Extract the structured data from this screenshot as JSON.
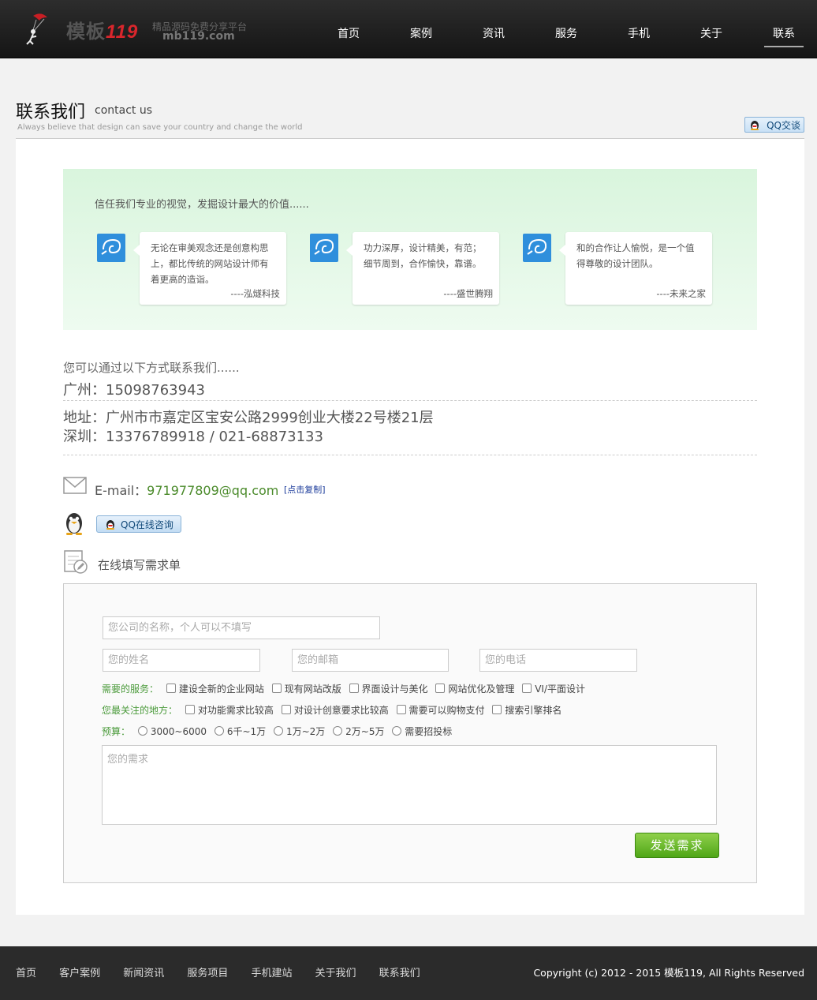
{
  "header": {
    "logo_cn": "模板",
    "logo_num": "119",
    "slogan": "精品源码免费分享平台",
    "domain": "mb119.com",
    "nav": [
      "首页",
      "案例",
      "资讯",
      "服务",
      "手机",
      "关于",
      "联系"
    ],
    "active_nav": "联系"
  },
  "page_title": {
    "cn": "联系我们",
    "en": "contact us",
    "subtitle": "Always believe that design can save your country and change the world",
    "qq_talk": "QQ交谈"
  },
  "testimonials": {
    "headline": "信任我们专业的视觉，发掘设计最大的价值......",
    "items": [
      {
        "text": "无论在审美观念还是创意构思上，都比传统的网站设计师有着更高的造诣。",
        "sign": "----泓燧科技"
      },
      {
        "text": "功力深厚，设计精美，有范；细节周到，合作愉快，靠谱。",
        "sign": "----盛世腾翔"
      },
      {
        "text": "和的合作让人愉悦，是一个值得尊敬的设计团队。",
        "sign": "----未来之家"
      }
    ]
  },
  "contact": {
    "intro": "您可以通过以下方式联系我们......",
    "guangzhou": "广州：15098763943",
    "address": "地址：广州市市嘉定区宝安公路2999创业大楼22号楼21层",
    "shenzhen": "深圳：13376789918 / 021-68873133",
    "email_label": "E-mail：",
    "email": "971977809@qq.com",
    "copy_link": "[点击复制]",
    "qq_online": "QQ在线咨询",
    "form_title": "在线填写需求单"
  },
  "form": {
    "company_placeholder": "您公司的名称，个人可以不填写",
    "name_placeholder": "您的姓名",
    "email_placeholder": "您的邮箱",
    "phone_placeholder": "您的电话",
    "services_label": "需要的服务：",
    "services": [
      "建设全新的企业网站",
      "现有网站改版",
      "界面设计与美化",
      "网站优化及管理",
      "VI/平面设计"
    ],
    "focus_label": "您最关注的地方：",
    "focus": [
      "对功能需求比较高",
      "对设计创意要求比较高",
      "需要可以购物支付",
      "搜索引擎排名"
    ],
    "budget_label": "预算：",
    "budget": [
      "3000~6000",
      "6千~1万",
      "1万~2万",
      "2万~5万",
      "需要招投标"
    ],
    "need_placeholder": "您的需求",
    "submit": "发送需求"
  },
  "footer": {
    "links": [
      "首页",
      "客户案例",
      "新闻资讯",
      "服务项目",
      "手机建站",
      "关于我们",
      "联系我们"
    ],
    "copyright": "Copyright (c) 2012 - 2015 模板119, All Rights Reserved"
  },
  "colors": {
    "header_bg": "#1e1e1e",
    "accent_green": "#4a9a3a",
    "testimonial_bg": "#e3f7e6",
    "footer_bg": "#2b2b2b"
  }
}
